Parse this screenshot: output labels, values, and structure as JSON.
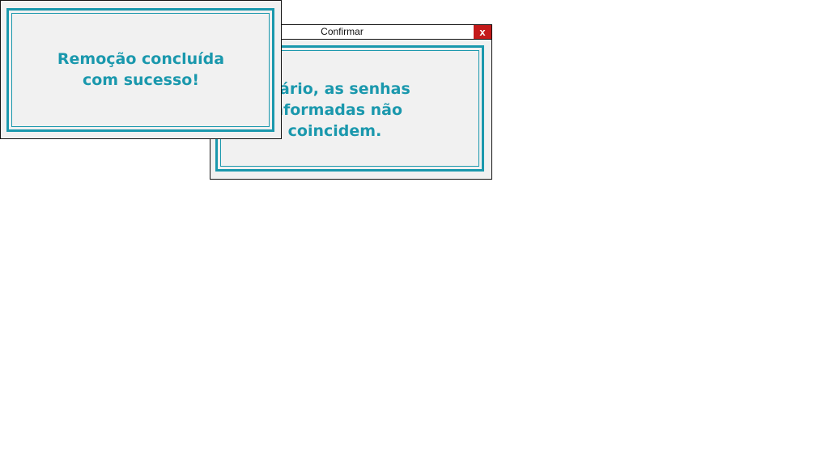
{
  "confirm_dialog": {
    "title": "Confirmar",
    "close_label": "x",
    "message": "suário, as senhas\ninformadas não\ncoincidem."
  },
  "success_dialog": {
    "message": "Remoção concluída\ncom sucesso!"
  },
  "colors": {
    "accent": "#1a98ad",
    "close_button": "#c41a1a",
    "dialog_background": "#f1f1f1"
  }
}
